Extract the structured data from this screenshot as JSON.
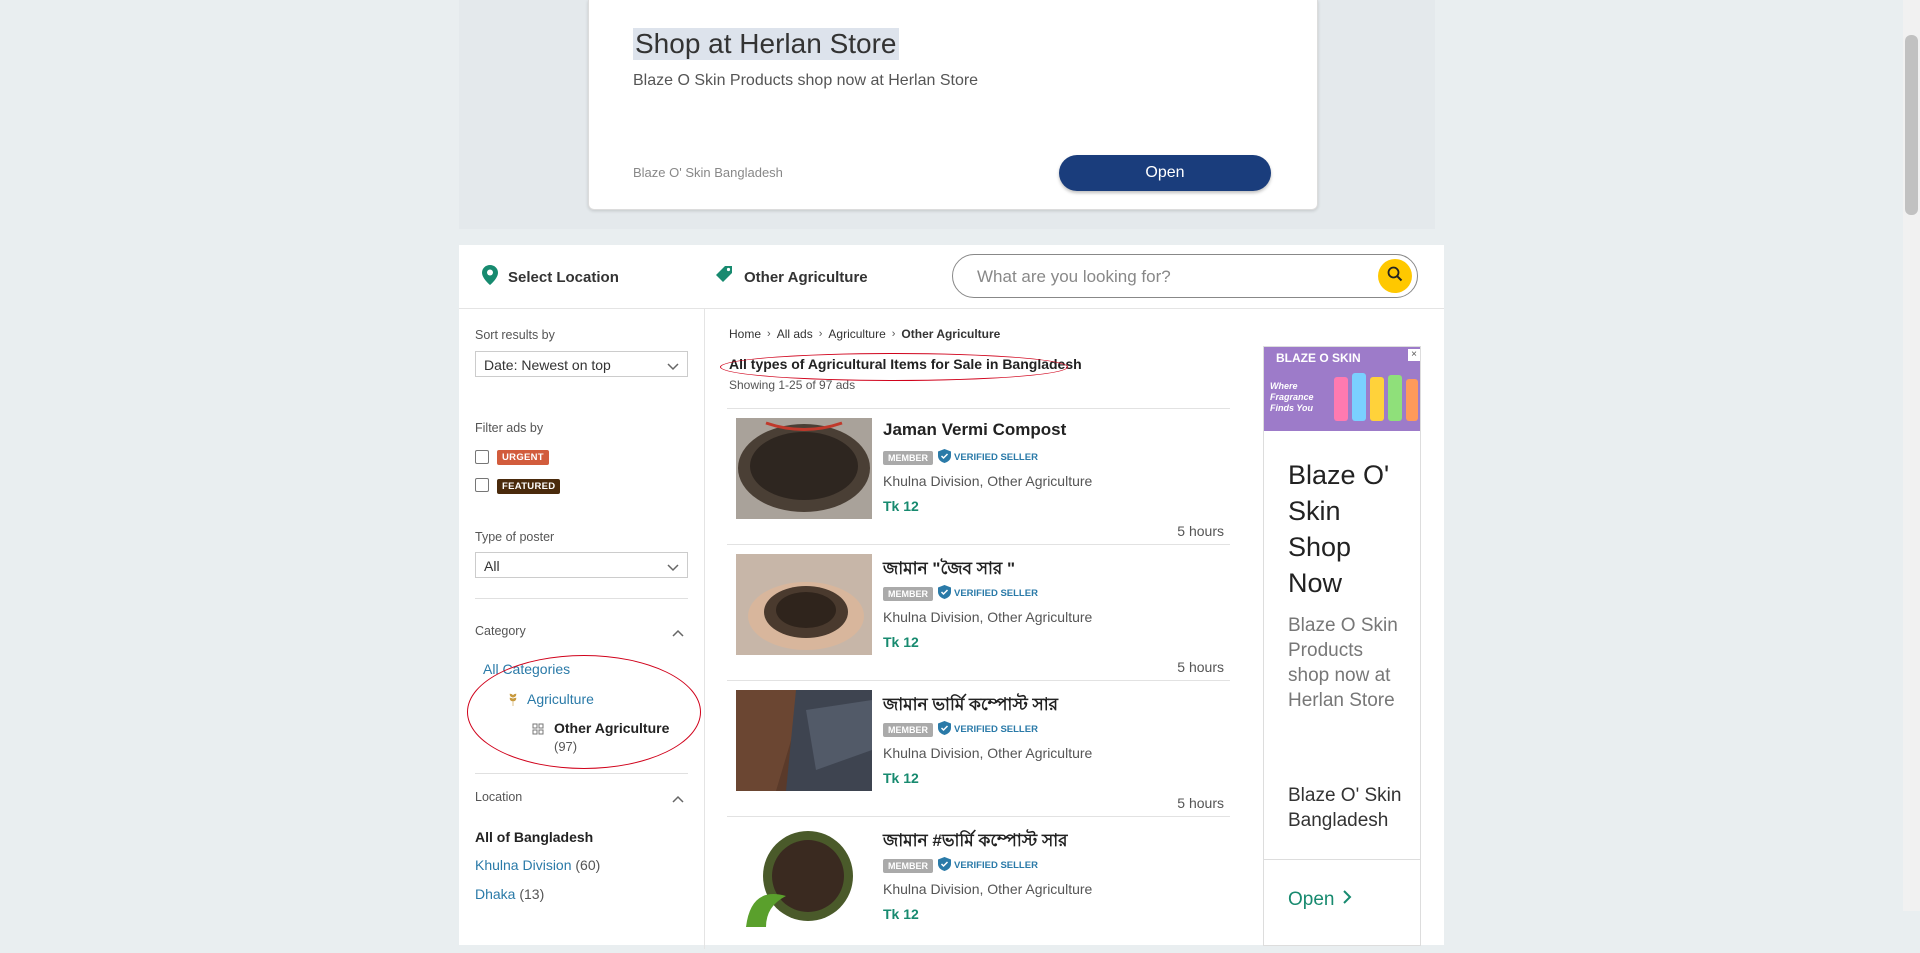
{
  "top_ad": {
    "title": "Shop at Herlan Store",
    "subtitle": "Blaze O Skin Products shop now at Herlan Store",
    "brand": "Blaze O' Skin Bangladesh",
    "open_label": "Open",
    "button_color": "#1a3d7c"
  },
  "header": {
    "location_label": "Select Location",
    "category_label": "Other Agriculture",
    "search_placeholder": "What are you looking for?",
    "accent_color": "#178a6f",
    "search_button_color": "#ffc800"
  },
  "sidebar": {
    "sort_label": "Sort results by",
    "sort_value": "Date: Newest on top",
    "filter_label": "Filter ads by",
    "filters": [
      "URGENT",
      "FEATURED"
    ],
    "poster_label": "Type of poster",
    "poster_value": "All",
    "category_heading": "Category",
    "all_categories": "All Categories",
    "category_parent": "Agriculture",
    "category_current": "Other Agriculture",
    "category_current_count": "(97)",
    "location_heading": "Location",
    "location_all": "All of Bangladesh",
    "locations": [
      {
        "name": "Khulna Division",
        "count": "(60)"
      },
      {
        "name": "Dhaka",
        "count": "(13)"
      }
    ]
  },
  "breadcrumb": [
    "Home",
    "All ads",
    "Agriculture",
    "Other Agriculture"
  ],
  "listing": {
    "heading": "All types of Agricultural Items for Sale in Bangladesh",
    "showing": "Showing 1-25 of 97 ads",
    "member_label": "MEMBER",
    "verified_label": "VERIFIED SELLER",
    "ads": [
      {
        "title": "Jaman Vermi Compost",
        "location": "Khulna Division, Other Agriculture",
        "price": "Tk 12",
        "time": "5 hours"
      },
      {
        "title": "জামান \"জৈব সার \"",
        "location": "Khulna Division, Other Agriculture",
        "price": "Tk 12",
        "time": "5 hours"
      },
      {
        "title": "জামান ভার্মি কম্পোস্ট সার",
        "location": "Khulna Division, Other Agriculture",
        "price": "Tk 12",
        "time": "5 hours"
      },
      {
        "title": "জামান #ভার্মি কম্পোস্ট সার",
        "location": "Khulna Division, Other Agriculture",
        "price": "Tk 12",
        "time": ""
      }
    ]
  },
  "side_ad": {
    "logo": "BLAZE O SKIN",
    "tagline": "Where Fragrance Finds You",
    "title": "Blaze O' Skin Shop Now",
    "subtitle": "Blaze O Skin Products shop now at Herlan Store",
    "brand": "Blaze O' Skin Bangladesh",
    "open_label": "Open"
  }
}
